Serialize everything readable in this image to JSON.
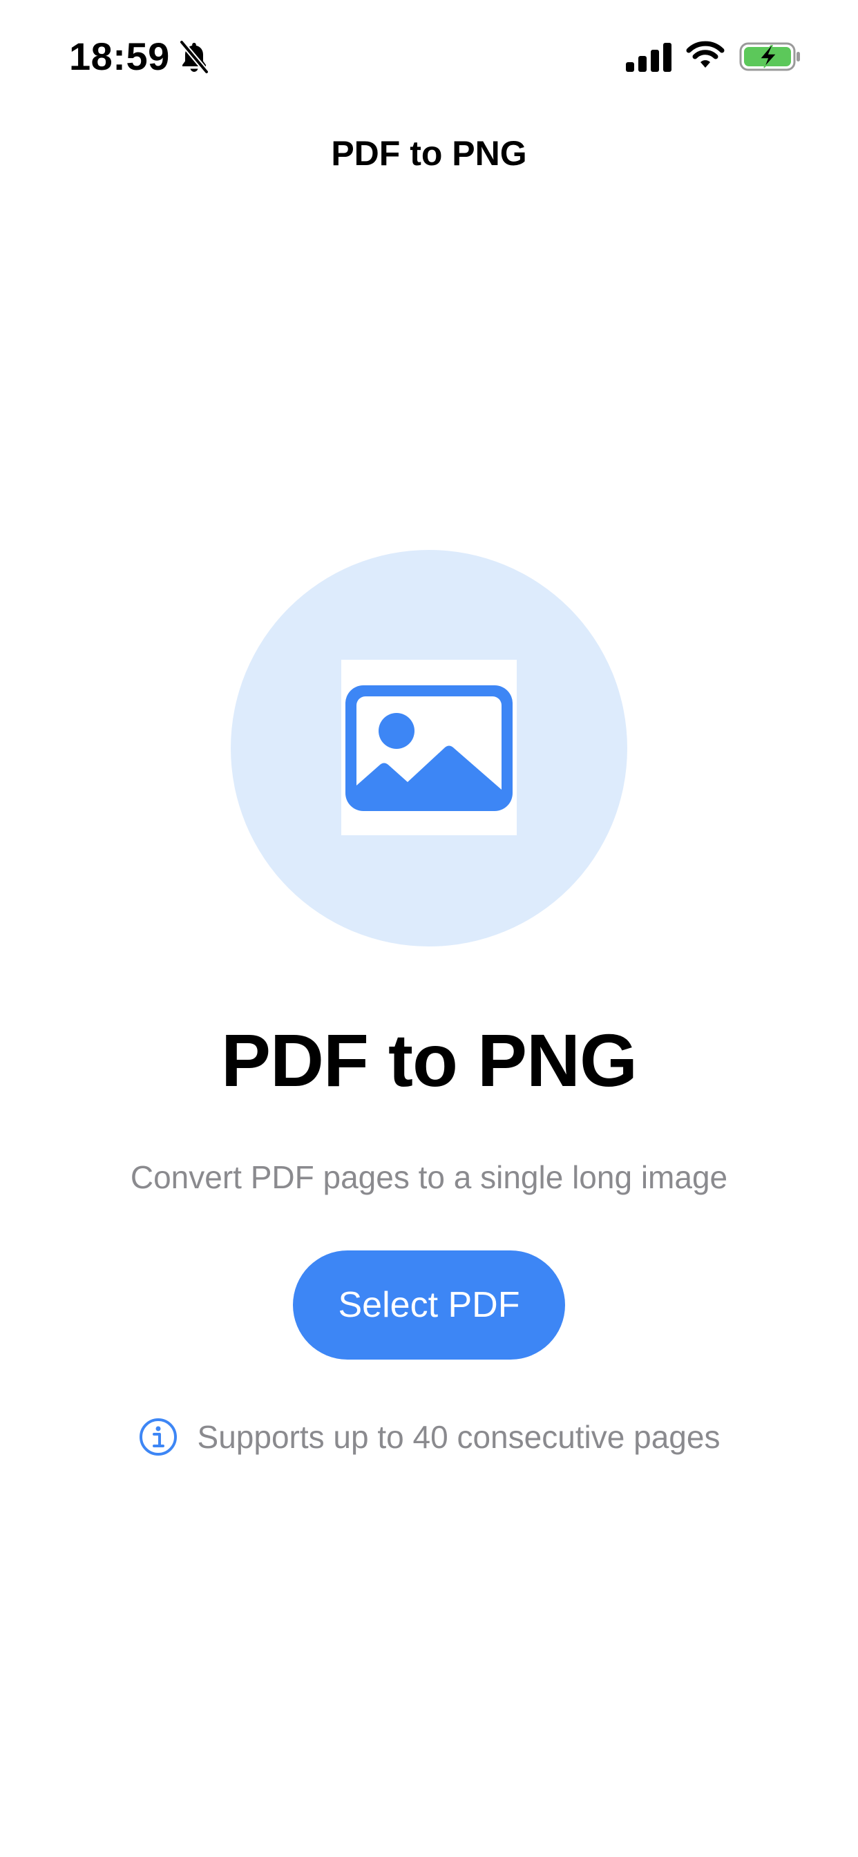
{
  "status_bar": {
    "time": "18:59",
    "icons": [
      "bell-slash-icon",
      "cellular-signal-icon",
      "wifi-icon",
      "battery-charging-icon"
    ]
  },
  "nav": {
    "title": "PDF to PNG"
  },
  "illustration": {
    "icon": "photo-icon"
  },
  "main": {
    "headline": "PDF to PNG",
    "subtitle": "Convert PDF pages to a single long image",
    "select_button_label": "Select PDF",
    "info_icon": "info-circle-icon",
    "info_text": "Supports up to 40 consecutive pages"
  },
  "colors": {
    "accent": "#3D86F5",
    "illustration_bg": "#DDEBFC",
    "secondary_text": "#8A8A8E",
    "battery_fill": "#5CC85A"
  }
}
